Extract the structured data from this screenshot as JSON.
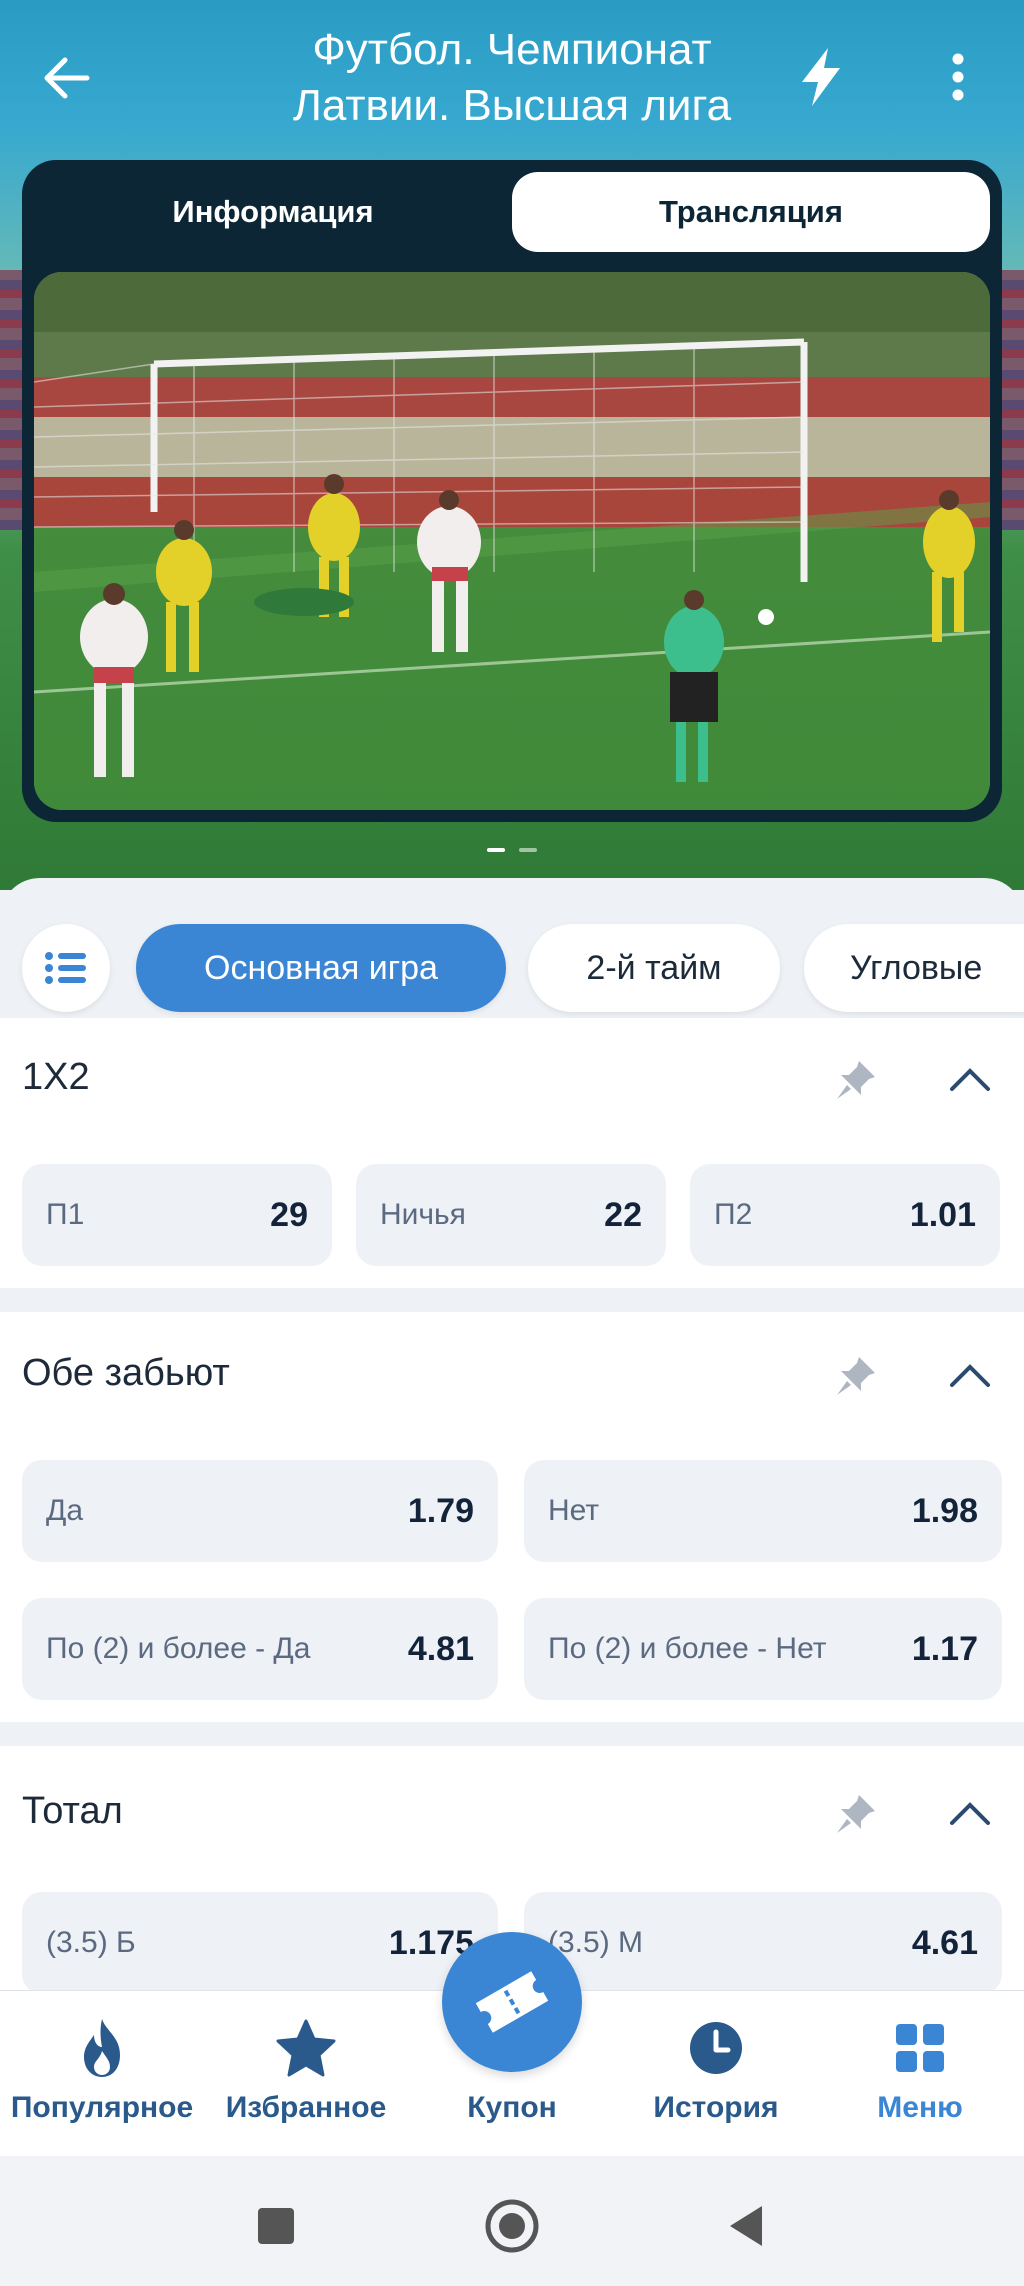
{
  "header": {
    "title_line1": "Футбол. Чемпионат",
    "title_line2": "Латвии. Высшая лига"
  },
  "segment": {
    "tabs": [
      {
        "label": "Информация",
        "active": false
      },
      {
        "label": "Трансляция",
        "active": true
      }
    ]
  },
  "carousel": {
    "pages": 2,
    "active": 0
  },
  "market_tabs": [
    {
      "label": "Основная игра",
      "active": true
    },
    {
      "label": "2-й тайм",
      "active": false
    },
    {
      "label": "Угловые",
      "active": false
    }
  ],
  "markets": {
    "m1x2": {
      "title": "1X2",
      "odds": [
        {
          "label": "П1",
          "value": "29"
        },
        {
          "label": "Ничья",
          "value": "22"
        },
        {
          "label": "П2",
          "value": "1.01"
        }
      ]
    },
    "both_score": {
      "title": "Обе забьют",
      "odds": [
        {
          "label": "Да",
          "value": "1.79"
        },
        {
          "label": "Нет",
          "value": "1.98"
        },
        {
          "label": "По (2) и более - Да",
          "value": "4.81"
        },
        {
          "label": "По (2) и более - Нет",
          "value": "1.17"
        }
      ]
    },
    "total": {
      "title": "Тотал",
      "odds": [
        {
          "label": "(3.5) Б",
          "value": "1.175"
        },
        {
          "label": "(3.5) М",
          "value": "4.61"
        }
      ]
    }
  },
  "bottom_nav": [
    {
      "label": "Популярное",
      "icon": "flame-icon"
    },
    {
      "label": "Избранное",
      "icon": "star-icon"
    },
    {
      "label": "Купон",
      "icon": "ticket-icon"
    },
    {
      "label": "История",
      "icon": "clock-icon"
    },
    {
      "label": "Меню",
      "icon": "grid-icon"
    }
  ],
  "colors": {
    "accent": "#3a86d4",
    "header_bg": "#2a9cc4",
    "card_bg": "#0c2636",
    "odd_bg": "#eef1f6"
  }
}
